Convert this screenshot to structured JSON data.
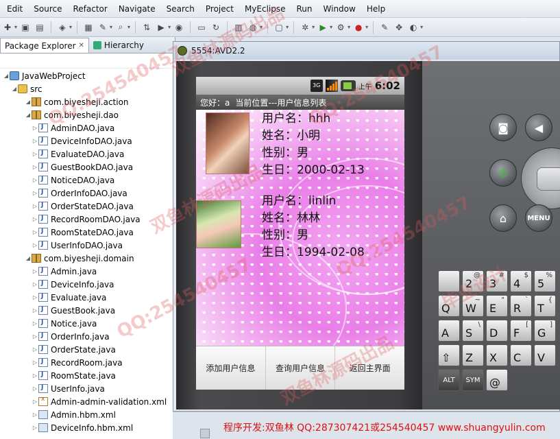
{
  "menubar": {
    "items": [
      "Edit",
      "Source",
      "Refactor",
      "Navigate",
      "Search",
      "Project",
      "MyEclipse",
      "Run",
      "Window",
      "Help"
    ]
  },
  "explorer": {
    "tabs": [
      {
        "label": "Package Explorer",
        "close": "✕"
      },
      {
        "label": "Hierarchy"
      }
    ],
    "tree": [
      {
        "label": "JavaWebProject",
        "level": 0,
        "icon": "project-icon"
      },
      {
        "label": "src",
        "level": 1,
        "icon": "source-folder-icon"
      },
      {
        "label": "com.biyesheji.action",
        "level": 2,
        "icon": "package-icon"
      },
      {
        "label": "com.biyesheji.dao",
        "level": 2,
        "icon": "package-icon"
      },
      {
        "label": "AdminDAO.java",
        "level": 3,
        "icon": "java-file-icon"
      },
      {
        "label": "DeviceInfoDAO.java",
        "level": 3,
        "icon": "java-file-icon"
      },
      {
        "label": "EvaluateDAO.java",
        "level": 3,
        "icon": "java-file-icon"
      },
      {
        "label": "GuestBookDAO.java",
        "level": 3,
        "icon": "java-file-icon"
      },
      {
        "label": "NoticeDAO.java",
        "level": 3,
        "icon": "java-file-icon"
      },
      {
        "label": "OrderInfoDAO.java",
        "level": 3,
        "icon": "java-file-icon"
      },
      {
        "label": "OrderStateDAO.java",
        "level": 3,
        "icon": "java-file-icon"
      },
      {
        "label": "RecordRoomDAO.java",
        "level": 3,
        "icon": "java-file-icon"
      },
      {
        "label": "RoomStateDAO.java",
        "level": 3,
        "icon": "java-file-icon"
      },
      {
        "label": "UserInfoDAO.java",
        "level": 3,
        "icon": "java-file-icon"
      },
      {
        "label": "com.biyesheji.domain",
        "level": 2,
        "icon": "package-icon"
      },
      {
        "label": "Admin.java",
        "level": 3,
        "icon": "java-file-icon"
      },
      {
        "label": "DeviceInfo.java",
        "level": 3,
        "icon": "java-file-icon"
      },
      {
        "label": "Evaluate.java",
        "level": 3,
        "icon": "java-file-icon"
      },
      {
        "label": "GuestBook.java",
        "level": 3,
        "icon": "java-file-icon"
      },
      {
        "label": "Notice.java",
        "level": 3,
        "icon": "java-file-icon"
      },
      {
        "label": "OrderInfo.java",
        "level": 3,
        "icon": "java-file-icon"
      },
      {
        "label": "OrderState.java",
        "level": 3,
        "icon": "java-file-icon"
      },
      {
        "label": "RecordRoom.java",
        "level": 3,
        "icon": "java-file-icon"
      },
      {
        "label": "RoomState.java",
        "level": 3,
        "icon": "java-file-icon"
      },
      {
        "label": "UserInfo.java",
        "level": 3,
        "icon": "java-file-icon"
      },
      {
        "label": "Admin-admin-validation.xml",
        "level": 3,
        "icon": "xml-file-icon"
      },
      {
        "label": "Admin.hbm.xml",
        "level": 3,
        "icon": "hbm-file-icon"
      },
      {
        "label": "DeviceInfo.hbm.xml",
        "level": 3,
        "icon": "hbm-file-icon"
      }
    ]
  },
  "emulator": {
    "title": "5554:AVD2.2",
    "status": {
      "network": "3G",
      "ampm": "上午",
      "time": "6:02"
    },
    "header": {
      "greeting": "您好：a",
      "location": "当前位置---用户信息列表"
    },
    "users": [
      {
        "username_line": "用户名：hhh",
        "name_line": "姓名：小明",
        "gender_line": "性别：男",
        "birthday_line": "生日：2000-02-13"
      },
      {
        "username_line": "用户名：linlin",
        "name_line": "姓名：林林",
        "gender_line": "性别：男",
        "birthday_line": "生日：1994-02-08"
      }
    ],
    "buttons": {
      "add": "添加用户信息",
      "query": "查询用户信息",
      "back": "返回主界面"
    },
    "hardware": {
      "menu": "MENU"
    },
    "keyboard": {
      "row1": [
        {
          "k": "",
          "s": ""
        },
        {
          "k": "2",
          "s": "@"
        },
        {
          "k": "3",
          "s": "#"
        },
        {
          "k": "4",
          "s": "$"
        },
        {
          "k": "5",
          "s": "%"
        }
      ],
      "row2": [
        {
          "k": "Q",
          "s": ""
        },
        {
          "k": "W",
          "s": "~"
        },
        {
          "k": "E",
          "s": "\""
        },
        {
          "k": "R",
          "s": "`"
        },
        {
          "k": "T",
          "s": "{"
        }
      ],
      "row3": [
        {
          "k": "A",
          "s": ""
        },
        {
          "k": "S",
          "s": "\\"
        },
        {
          "k": "D",
          "s": ""
        },
        {
          "k": "F",
          "s": "["
        },
        {
          "k": "G",
          "s": "]"
        }
      ],
      "row4": [
        {
          "k": "⇧",
          "s": ""
        },
        {
          "k": "Z",
          "s": ""
        },
        {
          "k": "X",
          "s": ""
        },
        {
          "k": "C",
          "s": ""
        },
        {
          "k": "V",
          "s": ""
        }
      ],
      "row5": [
        {
          "k": "ALT",
          "s": ""
        },
        {
          "k": "SYM",
          "s": ""
        },
        {
          "k": "@",
          "s": ""
        }
      ]
    }
  },
  "credit": "程序开发:双鱼林 QQ:287307421或254540457 www.shuangyulin.com",
  "watermarks": [
    "QQ:254540457",
    "双鱼林源码出品",
    "QQ:254540457",
    "双鱼林源码出品",
    "QQ:254540457",
    "毕业设计",
    "QQ:254540457",
    "双鱼林源码出品"
  ]
}
